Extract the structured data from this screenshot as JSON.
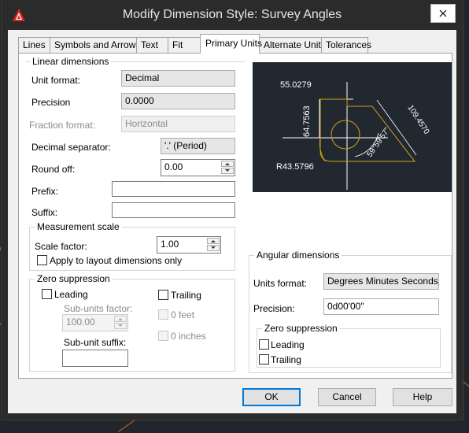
{
  "window": {
    "title": "Modify Dimension Style: Survey Angles"
  },
  "tabs": [
    "Lines",
    "Symbols and Arrows",
    "Text",
    "Fit",
    "Primary Units",
    "Alternate Units",
    "Tolerances"
  ],
  "linear": {
    "group_label": "Linear dimensions",
    "unit_format_label": "Unit format:",
    "unit_format_value": "Decimal",
    "precision_label": "Precision",
    "precision_value": "0.0000",
    "fraction_label": "Fraction format:",
    "fraction_value": "Horizontal",
    "decimal_sep_label": "Decimal separator:",
    "decimal_sep_value": "'.' (Period)",
    "roundoff_label": "Round off:",
    "roundoff_value": "0.00",
    "prefix_label": "Prefix:",
    "prefix_value": "",
    "suffix_label": "Suffix:",
    "suffix_value": ""
  },
  "measurement": {
    "group_label": "Measurement scale",
    "scale_label": "Scale factor:",
    "scale_value": "1.00",
    "apply_layout_label": "Apply to layout dimensions only"
  },
  "zero_linear": {
    "group_label": "Zero suppression",
    "leading_label": "Leading",
    "trailing_label": "Trailing",
    "subunits_factor_label": "Sub-units factor:",
    "subunits_factor_value": "100.00",
    "subunit_suffix_label": "Sub-unit suffix:",
    "subunit_suffix_value": "",
    "zero_feet_label": "0 feet",
    "zero_inches_label": "0 inches"
  },
  "preview": {
    "dim_top": "55.0279",
    "dim_vertical": "64.7563",
    "dim_angle": "59°59'57\"",
    "dim_aligned": "109.4570",
    "dim_radius": "R43.5796"
  },
  "angular": {
    "group_label": "Angular dimensions",
    "units_label": "Units format:",
    "units_value": "Degrees Minutes Seconds",
    "precision_label": "Precision:",
    "precision_value": "0d00'00\"",
    "zero_group_label": "Zero suppression",
    "leading_label": "Leading",
    "trailing_label": "Trailing"
  },
  "buttons": {
    "ok": "OK",
    "cancel": "Cancel",
    "help": "Help"
  },
  "colors": {
    "preview_bg": "#212830",
    "preview_line": "#ffffff",
    "preview_accent": "#d4a017",
    "title_bar": "#2b2b2b",
    "default_button_border": "#0078d7"
  }
}
